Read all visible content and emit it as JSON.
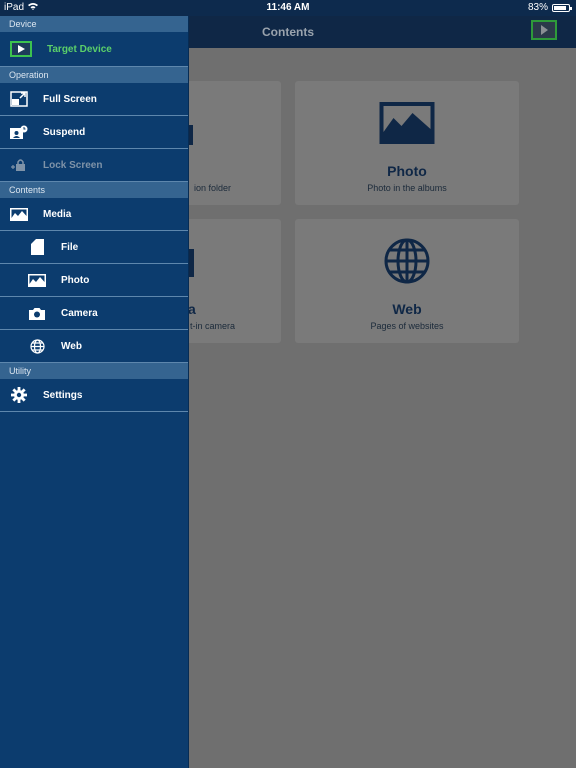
{
  "status": {
    "device": "iPad",
    "time": "11:46 AM",
    "battery": "83%",
    "battery_level": 0.83
  },
  "navbar": {
    "title": "Contents"
  },
  "cards": [
    {
      "title": "",
      "subtitle": "ion folder",
      "icon": "folder-icon"
    },
    {
      "title": "Photo",
      "subtitle": "Photo in the albums",
      "icon": "photo-icon"
    },
    {
      "title": "a",
      "subtitle": "t-in camera",
      "icon": "camera-icon"
    },
    {
      "title": "Web",
      "subtitle": "Pages of websites",
      "icon": "globe-icon"
    }
  ],
  "menu": {
    "sections": {
      "device": "Device",
      "operation": "Operation",
      "contents": "Contents",
      "utility": "Utility"
    },
    "target_device": "Target Device",
    "full_screen": "Full Screen",
    "suspend": "Suspend",
    "lock_screen": "Lock Screen",
    "media": "Media",
    "file": "File",
    "photo": "Photo",
    "camera": "Camera",
    "web": "Web",
    "settings": "Settings"
  },
  "colors": {
    "menu_bg": "#0c3c6e",
    "section_bg": "#356490",
    "active_green": "#5bd06a"
  }
}
